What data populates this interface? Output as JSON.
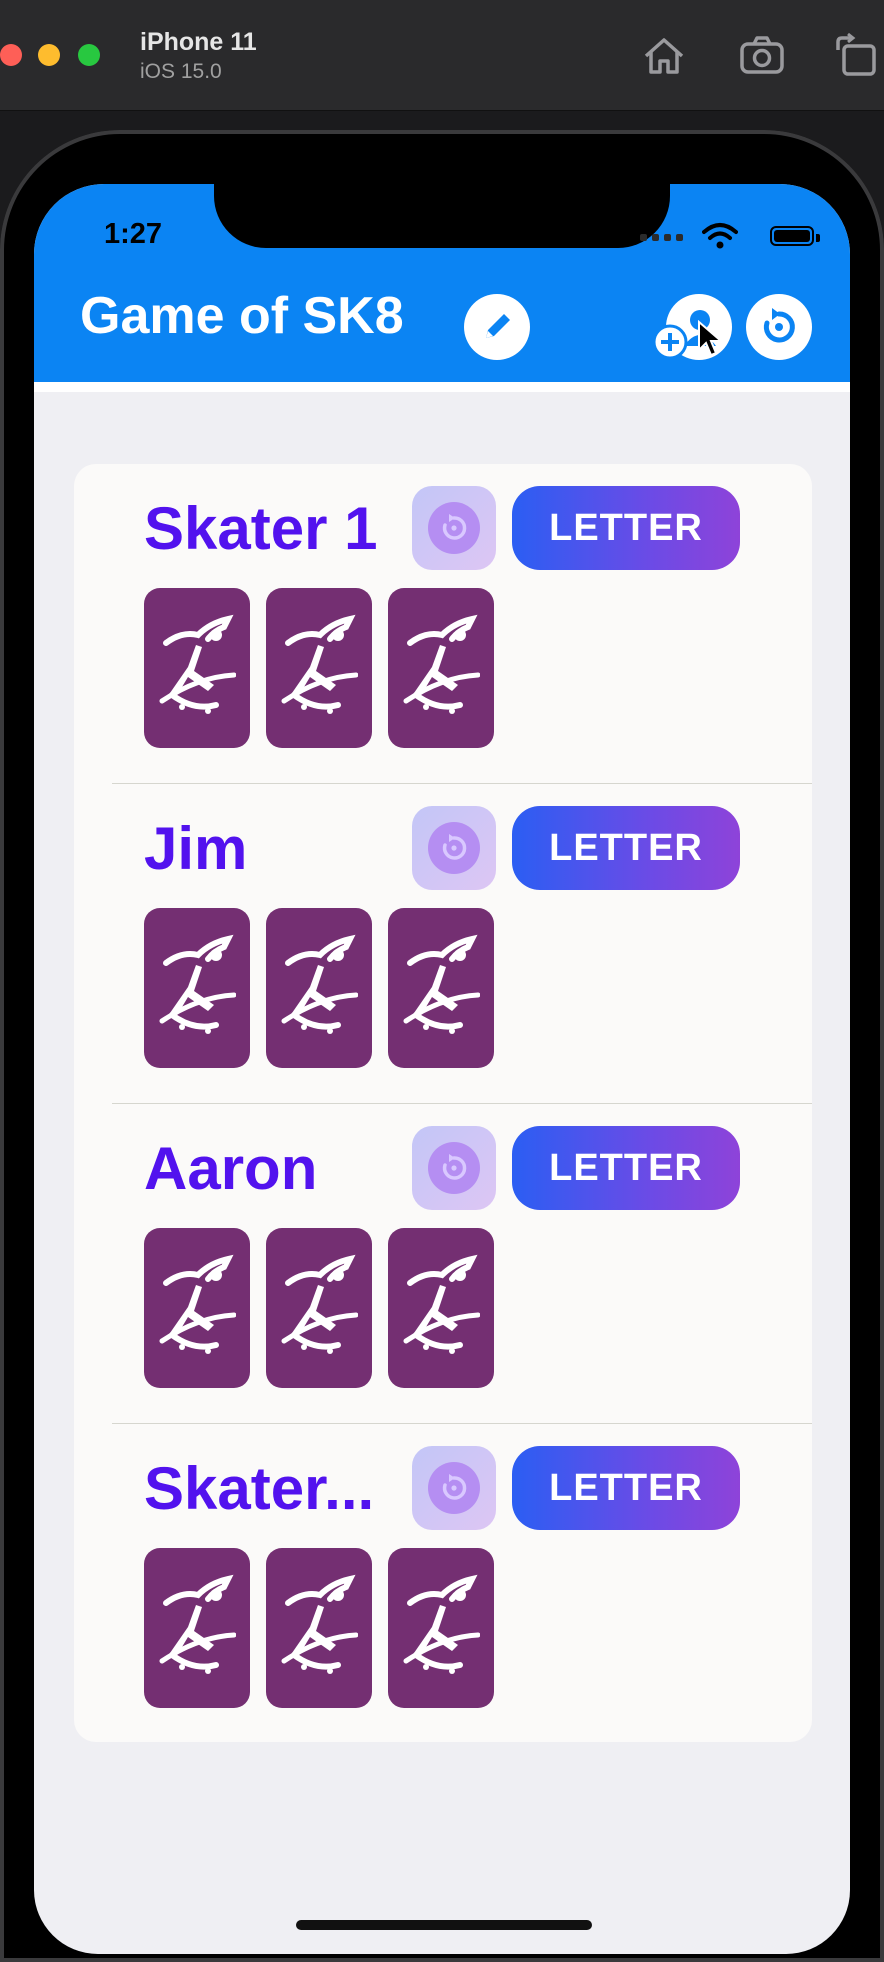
{
  "simulator": {
    "device_name": "iPhone 11",
    "os_version": "iOS 15.0",
    "toolbar_icons": [
      "home-icon",
      "screenshot-icon",
      "rotate-icon"
    ]
  },
  "status_bar": {
    "time": "1:27",
    "icons": [
      "cellular-signal-icon",
      "wifi-icon",
      "battery-icon"
    ]
  },
  "header": {
    "title": "Game of SK8",
    "buttons": [
      "edit-pencil-icon",
      "add-player-icon",
      "reset-game-icon"
    ],
    "accent_color": "#0b84f3"
  },
  "players": [
    {
      "name": "Skater 1",
      "letter_label": "LETTER",
      "tiles": [
        "skater-icon",
        "skater-icon",
        "skater-icon"
      ]
    },
    {
      "name": "Jim",
      "letter_label": "LETTER",
      "tiles": [
        "skater-icon",
        "skater-icon",
        "skater-icon"
      ]
    },
    {
      "name": "Aaron",
      "letter_label": "LETTER",
      "tiles": [
        "skater-icon",
        "skater-icon",
        "skater-icon"
      ]
    },
    {
      "name": "Skater...",
      "letter_label": "LETTER",
      "tiles": [
        "skater-icon",
        "skater-icon",
        "skater-icon"
      ]
    }
  ],
  "colors": {
    "player_name": "#5212ee",
    "tile": "#742f72",
    "letter_gradient_start": "#2b5ef3",
    "letter_gradient_end": "#8e43d9"
  }
}
